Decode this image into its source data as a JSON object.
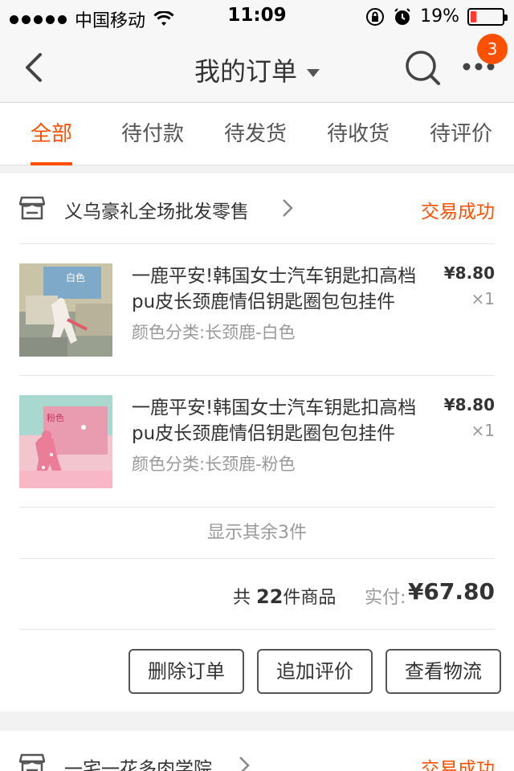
{
  "status_bar": {
    "carrier": "中国移动",
    "time": "11:09",
    "battery_percent": "19%",
    "battery_level": 0.19
  },
  "nav": {
    "title": "我的订单",
    "badge_count": "3"
  },
  "tabs": [
    {
      "label": "全部",
      "active": true
    },
    {
      "label": "待付款"
    },
    {
      "label": "待发货"
    },
    {
      "label": "待收货"
    },
    {
      "label": "待评价"
    }
  ],
  "orders": [
    {
      "shop_name": "义乌豪礼全场批发零售",
      "status": "交易成功",
      "items": [
        {
          "title_line1": "一鹿平安!韩国女士汽车钥匙扣高档",
          "title_line2": "pu皮长颈鹿情侣钥匙圈包包挂件",
          "sku": "颜色分类:长颈鹿-白色",
          "price": "¥8.80",
          "qty": "×1",
          "thumb_text": "白色"
        },
        {
          "title_line1": "一鹿平安!韩国女士汽车钥匙扣高档",
          "title_line2": "pu皮长颈鹿情侣钥匙圈包包挂件",
          "sku": "颜色分类:长颈鹿-粉色",
          "price": "¥8.80",
          "qty": "×1",
          "thumb_text": "粉色"
        }
      ],
      "show_more": "显示其余3件",
      "total_prefix": "共",
      "total_count": "22",
      "total_suffix": "件商品",
      "paid_label": "实付:",
      "paid_amount": "¥67.80",
      "actions": [
        "删除订单",
        "追加评价",
        "查看物流"
      ]
    },
    {
      "shop_name": "一宅一花多肉学院",
      "status": "交易成功"
    }
  ],
  "colors": {
    "accent": "#ff5000",
    "battery_low": "#ff3b30"
  },
  "icons": [
    "back-icon",
    "search-icon",
    "more-icon",
    "shop-icon",
    "chevron-right-icon",
    "wifi-icon",
    "lock-rotation-icon",
    "alarm-icon"
  ]
}
